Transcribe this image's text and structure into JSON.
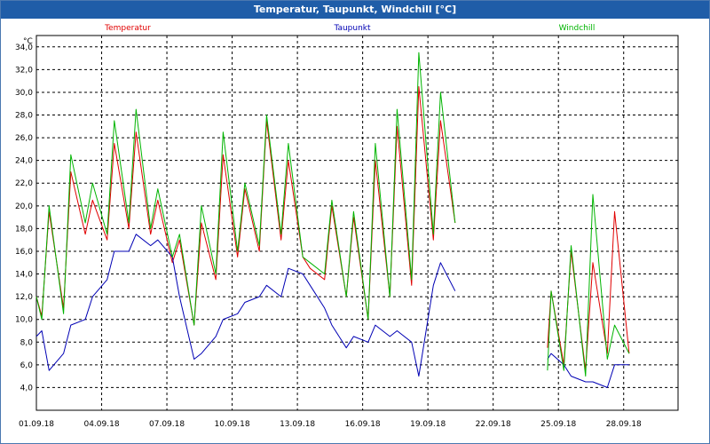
{
  "window": {
    "title": "Temperatur, Taupunkt, Windchill [°C]"
  },
  "chart_data": {
    "type": "line",
    "title": "Temperatur, Taupunkt, Windchill [°C]",
    "ylabel": "°C",
    "xlabel": "",
    "ylim": [
      2.0,
      35.0
    ],
    "xlim": [
      "2018-09-01 00:00",
      "2018-09-30 12:00"
    ],
    "grid": true,
    "y_ticks": [
      "4,0",
      "6,0",
      "8,0",
      "10,0",
      "12,0",
      "14,0",
      "16,0",
      "18,0",
      "20,0",
      "22,0",
      "24,0",
      "26,0",
      "28,0",
      "30,0",
      "32,0",
      "34,0"
    ],
    "x_ticks": [
      "01.09.18",
      "04.09.18",
      "07.09.18",
      "10.09.18",
      "13.09.18",
      "16.09.18",
      "19.09.18",
      "22.09.18",
      "25.09.18",
      "28.09.18"
    ],
    "legend": [
      "Temperatur",
      "Taupunkt",
      "Windchill"
    ],
    "colors": {
      "Temperatur": "#e00000",
      "Taupunkt": "#0000b4",
      "Windchill": "#00b400"
    },
    "series": [
      {
        "name": "Temperatur",
        "x": [
          "2018-09-01 00:00",
          "2018-09-01 06:00",
          "2018-09-01 14:00",
          "2018-09-02 06:00",
          "2018-09-02 14:00",
          "2018-09-03 06:00",
          "2018-09-03 14:00",
          "2018-09-04 06:00",
          "2018-09-04 14:00",
          "2018-09-05 06:00",
          "2018-09-05 14:00",
          "2018-09-06 06:00",
          "2018-09-06 14:00",
          "2018-09-07 06:00",
          "2018-09-07 14:00",
          "2018-09-08 06:00",
          "2018-09-08 14:00",
          "2018-09-09 06:00",
          "2018-09-09 14:00",
          "2018-09-10 06:00",
          "2018-09-10 14:00",
          "2018-09-11 06:00",
          "2018-09-11 14:00",
          "2018-09-12 06:00",
          "2018-09-12 14:00",
          "2018-09-13 06:00",
          "2018-09-13 14:00",
          "2018-09-14 06:00",
          "2018-09-14 14:00",
          "2018-09-15 06:00",
          "2018-09-15 14:00",
          "2018-09-16 06:00",
          "2018-09-16 14:00",
          "2018-09-17 06:00",
          "2018-09-17 14:00",
          "2018-09-18 06:00",
          "2018-09-18 14:00",
          "2018-09-19 06:00",
          "2018-09-19 14:00",
          "2018-09-20 06:00",
          "2018-09-20 14:00",
          null,
          "2018-09-24 12:00",
          "2018-09-24 16:00",
          "2018-09-25 06:00",
          "2018-09-25 14:00",
          "2018-09-26 06:00",
          "2018-09-26 14:00",
          "2018-09-27 06:00",
          "2018-09-27 14:00",
          "2018-09-28 06:00"
        ],
        "y": [
          12.0,
          10.3,
          19.5,
          11.0,
          23.0,
          17.5,
          20.5,
          17.0,
          25.5,
          18.0,
          26.5,
          17.5,
          20.5,
          15.0,
          17.0,
          9.5,
          18.5,
          13.5,
          24.5,
          15.5,
          21.5,
          16.0,
          27.5,
          17.0,
          24.0,
          15.5,
          14.5,
          13.5,
          20.0,
          12.0,
          19.0,
          10.0,
          24.0,
          12.0,
          27.0,
          13.0,
          30.5,
          17.0,
          27.5,
          18.5,
          null,
          null,
          7.5,
          12.5,
          6.0,
          16.0,
          5.5,
          15.0,
          7.0,
          19.5,
          7.0
        ]
      },
      {
        "name": "Taupunkt",
        "x": [
          "2018-09-01 00:00",
          "2018-09-01 06:00",
          "2018-09-01 14:00",
          "2018-09-02 06:00",
          "2018-09-02 14:00",
          "2018-09-03 06:00",
          "2018-09-03 14:00",
          "2018-09-04 06:00",
          "2018-09-04 14:00",
          "2018-09-05 06:00",
          "2018-09-05 14:00",
          "2018-09-06 06:00",
          "2018-09-06 14:00",
          "2018-09-07 06:00",
          "2018-09-07 14:00",
          "2018-09-08 06:00",
          "2018-09-08 14:00",
          "2018-09-09 06:00",
          "2018-09-09 14:00",
          "2018-09-10 06:00",
          "2018-09-10 14:00",
          "2018-09-11 06:00",
          "2018-09-11 14:00",
          "2018-09-12 06:00",
          "2018-09-12 14:00",
          "2018-09-13 06:00",
          "2018-09-13 14:00",
          "2018-09-14 06:00",
          "2018-09-14 14:00",
          "2018-09-15 06:00",
          "2018-09-15 14:00",
          "2018-09-16 06:00",
          "2018-09-16 14:00",
          "2018-09-17 06:00",
          "2018-09-17 14:00",
          "2018-09-18 06:00",
          "2018-09-18 14:00",
          "2018-09-19 06:00",
          "2018-09-19 14:00",
          "2018-09-20 06:00",
          "2018-09-20 14:00",
          null,
          "2018-09-24 12:00",
          "2018-09-24 16:00",
          "2018-09-25 06:00",
          "2018-09-25 14:00",
          "2018-09-26 06:00",
          "2018-09-26 14:00",
          "2018-09-27 06:00",
          "2018-09-27 14:00",
          "2018-09-28 06:00"
        ],
        "y": [
          8.5,
          9.0,
          5.5,
          7.0,
          9.5,
          10.0,
          12.0,
          13.5,
          16.0,
          16.0,
          17.5,
          16.5,
          17.0,
          15.5,
          12.0,
          6.5,
          7.0,
          8.5,
          10.0,
          10.5,
          11.5,
          12.0,
          13.0,
          12.0,
          14.5,
          14.0,
          13.0,
          11.0,
          9.5,
          7.5,
          8.5,
          8.0,
          9.5,
          8.5,
          9.0,
          8.0,
          5.0,
          13.0,
          15.0,
          12.5,
          null,
          null,
          6.5,
          7.0,
          6.0,
          5.0,
          4.5,
          4.5,
          4.0,
          6.0,
          6.0
        ]
      },
      {
        "name": "Windchill",
        "x": [
          "2018-09-01 00:00",
          "2018-09-01 06:00",
          "2018-09-01 14:00",
          "2018-09-02 06:00",
          "2018-09-02 14:00",
          "2018-09-03 06:00",
          "2018-09-03 14:00",
          "2018-09-04 06:00",
          "2018-09-04 14:00",
          "2018-09-05 06:00",
          "2018-09-05 14:00",
          "2018-09-06 06:00",
          "2018-09-06 14:00",
          "2018-09-07 06:00",
          "2018-09-07 14:00",
          "2018-09-08 06:00",
          "2018-09-08 14:00",
          "2018-09-09 06:00",
          "2018-09-09 14:00",
          "2018-09-10 06:00",
          "2018-09-10 14:00",
          "2018-09-11 06:00",
          "2018-09-11 14:00",
          "2018-09-12 06:00",
          "2018-09-12 14:00",
          "2018-09-13 06:00",
          "2018-09-13 14:00",
          "2018-09-14 06:00",
          "2018-09-14 14:00",
          "2018-09-15 06:00",
          "2018-09-15 14:00",
          "2018-09-16 06:00",
          "2018-09-16 14:00",
          "2018-09-17 06:00",
          "2018-09-17 14:00",
          "2018-09-18 06:00",
          "2018-09-18 14:00",
          "2018-09-19 06:00",
          "2018-09-19 14:00",
          "2018-09-20 06:00",
          "2018-09-20 14:00",
          null,
          "2018-09-24 12:00",
          "2018-09-24 16:00",
          "2018-09-25 06:00",
          "2018-09-25 14:00",
          "2018-09-26 06:00",
          "2018-09-26 14:00",
          "2018-09-27 06:00",
          "2018-09-27 14:00",
          "2018-09-28 06:00"
        ],
        "y": [
          12.0,
          10.0,
          20.0,
          10.5,
          24.5,
          18.5,
          22.0,
          17.5,
          27.5,
          18.5,
          28.5,
          18.0,
          21.5,
          15.5,
          17.5,
          9.5,
          20.0,
          14.0,
          26.5,
          16.0,
          22.0,
          16.5,
          28.0,
          17.5,
          25.5,
          15.5,
          15.0,
          14.0,
          20.5,
          12.0,
          19.5,
          10.0,
          25.5,
          12.0,
          28.5,
          13.5,
          33.5,
          17.5,
          30.0,
          18.5,
          null,
          null,
          5.5,
          12.5,
          5.5,
          16.5,
          5.0,
          21.0,
          6.5,
          9.5,
          7.0
        ]
      }
    ]
  }
}
